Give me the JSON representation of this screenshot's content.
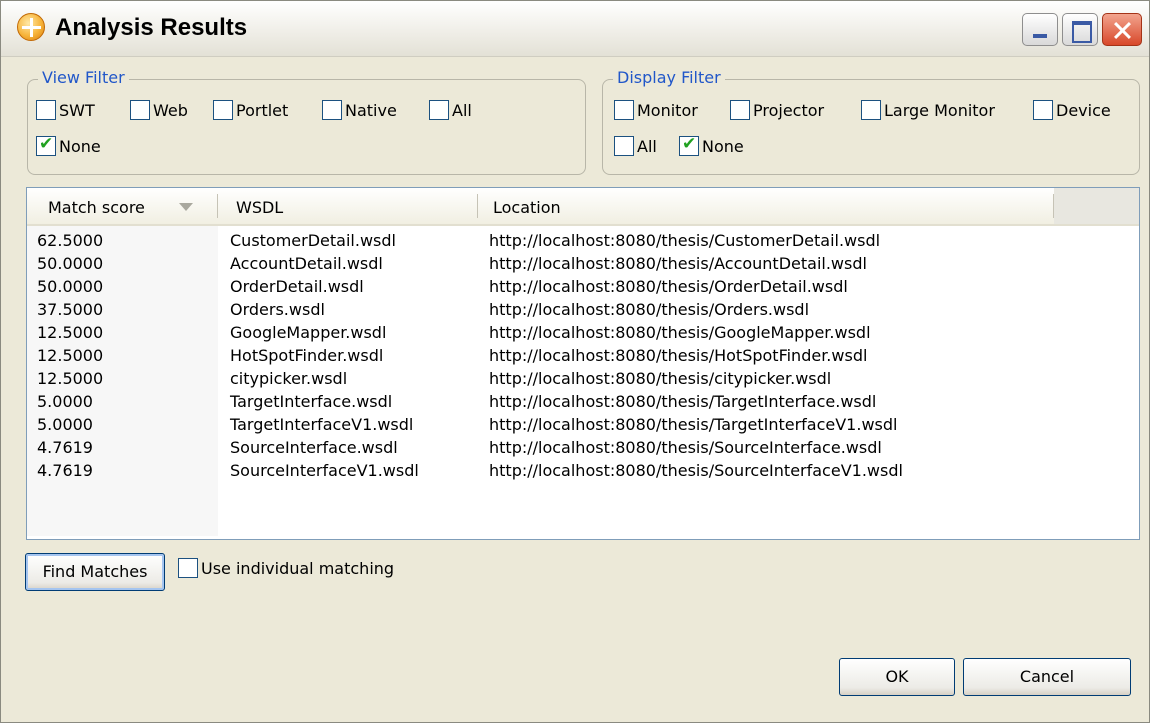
{
  "window": {
    "title": "Analysis Results",
    "icon": "app-icon"
  },
  "view_filter": {
    "legend": "View Filter",
    "options": [
      {
        "label": "SWT",
        "checked": false
      },
      {
        "label": "Web",
        "checked": false
      },
      {
        "label": "Portlet",
        "checked": false
      },
      {
        "label": "Native",
        "checked": false
      },
      {
        "label": "All",
        "checked": false
      },
      {
        "label": "None",
        "checked": true
      }
    ]
  },
  "display_filter": {
    "legend": "Display Filter",
    "options": [
      {
        "label": "Monitor",
        "checked": false
      },
      {
        "label": "Projector",
        "checked": false
      },
      {
        "label": "Large Monitor",
        "checked": false
      },
      {
        "label": "Device",
        "checked": false
      },
      {
        "label": "All",
        "checked": false
      },
      {
        "label": "None",
        "checked": true
      }
    ]
  },
  "table": {
    "columns": [
      "Match score",
      "WSDL",
      "Location"
    ],
    "sort_column": "Match score",
    "rows": [
      {
        "score": "62.5000",
        "wsdl": "CustomerDetail.wsdl",
        "location": "http://localhost:8080/thesis/CustomerDetail.wsdl"
      },
      {
        "score": "50.0000",
        "wsdl": "AccountDetail.wsdl",
        "location": "http://localhost:8080/thesis/AccountDetail.wsdl"
      },
      {
        "score": "50.0000",
        "wsdl": "OrderDetail.wsdl",
        "location": "http://localhost:8080/thesis/OrderDetail.wsdl"
      },
      {
        "score": "37.5000",
        "wsdl": "Orders.wsdl",
        "location": "http://localhost:8080/thesis/Orders.wsdl"
      },
      {
        "score": "12.5000",
        "wsdl": "GoogleMapper.wsdl",
        "location": "http://localhost:8080/thesis/GoogleMapper.wsdl"
      },
      {
        "score": "12.5000",
        "wsdl": "HotSpotFinder.wsdl",
        "location": "http://localhost:8080/thesis/HotSpotFinder.wsdl"
      },
      {
        "score": "12.5000",
        "wsdl": "citypicker.wsdl",
        "location": "http://localhost:8080/thesis/citypicker.wsdl"
      },
      {
        "score": "5.0000",
        "wsdl": "TargetInterface.wsdl",
        "location": "http://localhost:8080/thesis/TargetInterface.wsdl"
      },
      {
        "score": "5.0000",
        "wsdl": "TargetInterfaceV1.wsdl",
        "location": "http://localhost:8080/thesis/TargetInterfaceV1.wsdl"
      },
      {
        "score": "4.7619",
        "wsdl": "SourceInterface.wsdl",
        "location": "http://localhost:8080/thesis/SourceInterface.wsdl"
      },
      {
        "score": "4.7619",
        "wsdl": "SourceInterfaceV1.wsdl",
        "location": "http://localhost:8080/thesis/SourceInterfaceV1.wsdl"
      }
    ]
  },
  "actions": {
    "find_matches_label": "Find Matches",
    "individual_matching": {
      "label": "Use individual matching",
      "checked": false
    },
    "ok_label": "OK",
    "cancel_label": "Cancel"
  }
}
